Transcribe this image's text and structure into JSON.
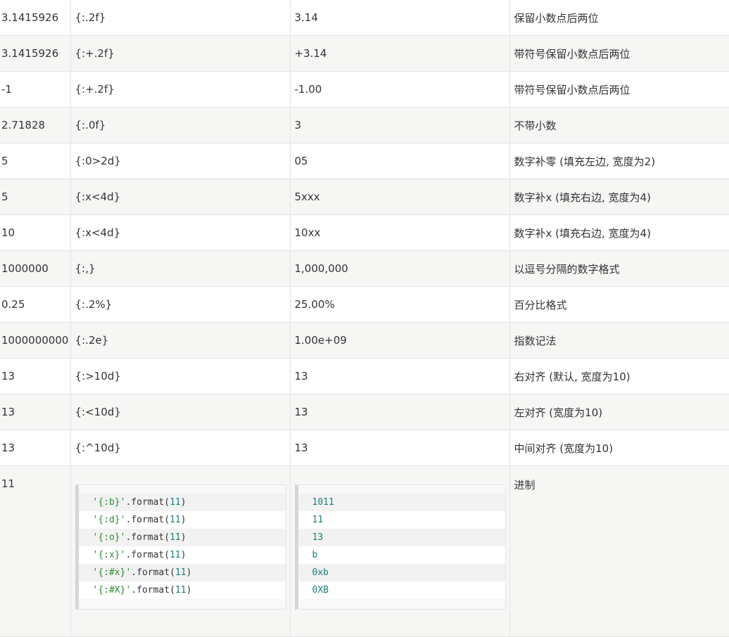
{
  "rows": [
    {
      "num": "3.1415926",
      "fmt": "{:.2f}",
      "out": "3.14",
      "desc": "保留小数点后两位"
    },
    {
      "num": "3.1415926",
      "fmt": "{:+.2f}",
      "out": "+3.14",
      "desc": "带符号保留小数点后两位"
    },
    {
      "num": "-1",
      "fmt": "{:+.2f}",
      "out": "-1.00",
      "desc": "带符号保留小数点后两位"
    },
    {
      "num": "2.71828",
      "fmt": "{:.0f}",
      "out": "3",
      "desc": "不带小数"
    },
    {
      "num": "5",
      "fmt": "{:0>2d}",
      "out": "05",
      "desc": "数字补零 (填充左边, 宽度为2)"
    },
    {
      "num": "5",
      "fmt": "{:x<4d}",
      "out": "5xxx",
      "desc": "数字补x (填充右边, 宽度为4)"
    },
    {
      "num": "10",
      "fmt": "{:x<4d}",
      "out": "10xx",
      "desc": "数字补x (填充右边, 宽度为4)"
    },
    {
      "num": "1000000",
      "fmt": "{:,}",
      "out": "1,000,000",
      "desc": "以逗号分隔的数字格式"
    },
    {
      "num": "0.25",
      "fmt": "{:.2%}",
      "out": "25.00%",
      "desc": "百分比格式"
    },
    {
      "num": "1000000000",
      "fmt": "{:.2e}",
      "out": "1.00e+09",
      "desc": "指数记法"
    },
    {
      "num": "13",
      "fmt": "{:>10d}",
      "out": "        13",
      "desc": "右对齐 (默认, 宽度为10)"
    },
    {
      "num": "13",
      "fmt": "{:<10d}",
      "out": "13",
      "desc": "左对齐 (宽度为10)"
    },
    {
      "num": "13",
      "fmt": "{:^10d}",
      "out": "    13",
      "desc": "中间对齐 (宽度为10)"
    }
  ],
  "base_row": {
    "num": "11",
    "desc": "进制",
    "code": [
      {
        "str": "'{:b}'",
        "fn": ".format(",
        "arg": "11",
        "close": ")"
      },
      {
        "str": "'{:d}'",
        "fn": ".format(",
        "arg": "11",
        "close": ")"
      },
      {
        "str": "'{:o}'",
        "fn": ".format(",
        "arg": "11",
        "close": ")"
      },
      {
        "str": "'{:x}'",
        "fn": ".format(",
        "arg": "11",
        "close": ")"
      },
      {
        "str": "'{:#x}'",
        "fn": ".format(",
        "arg": "11",
        "close": ")"
      },
      {
        "str": "'{:#X}'",
        "fn": ".format(",
        "arg": "11",
        "close": ")"
      }
    ],
    "output": [
      "1011",
      "11",
      "13",
      "b",
      "0xb",
      "0XB"
    ]
  }
}
